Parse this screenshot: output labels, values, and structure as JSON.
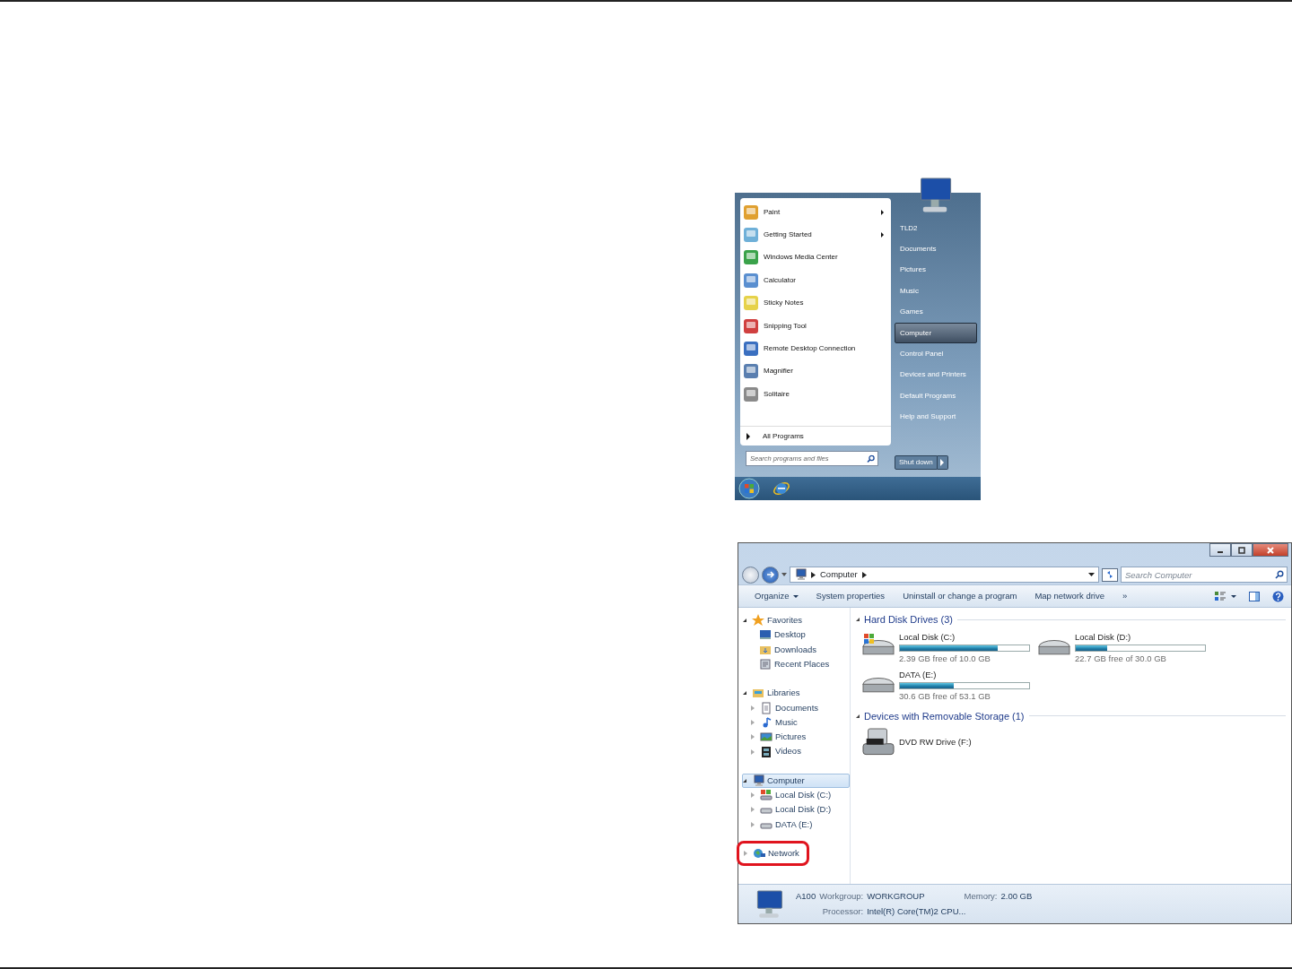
{
  "start_menu": {
    "programs": [
      {
        "label": "Paint",
        "has_submenu": true
      },
      {
        "label": "Getting Started",
        "has_submenu": true
      },
      {
        "label": "Windows Media Center",
        "has_submenu": false
      },
      {
        "label": "Calculator",
        "has_submenu": false
      },
      {
        "label": "Sticky Notes",
        "has_submenu": false
      },
      {
        "label": "Snipping Tool",
        "has_submenu": false
      },
      {
        "label": "Remote Desktop Connection",
        "has_submenu": false
      },
      {
        "label": "Magnifier",
        "has_submenu": false
      },
      {
        "label": "Solitaire",
        "has_submenu": false
      }
    ],
    "all_programs": "All Programs",
    "search": {
      "placeholder": "Search programs and files"
    },
    "places": [
      {
        "label": "TLD2",
        "selected": false
      },
      {
        "label": "Documents",
        "selected": false
      },
      {
        "label": "Pictures",
        "selected": false
      },
      {
        "label": "Music",
        "selected": false
      },
      {
        "label": "Games",
        "selected": false
      },
      {
        "label": "Computer",
        "selected": true
      },
      {
        "label": "Control Panel",
        "selected": false
      },
      {
        "label": "Devices and Printers",
        "selected": false
      },
      {
        "label": "Default Programs",
        "selected": false
      },
      {
        "label": "Help and Support",
        "selected": false
      }
    ],
    "shutdown": "Shut down"
  },
  "explorer": {
    "address": [
      "Computer"
    ],
    "search": {
      "placeholder": "Search Computer"
    },
    "toolbar": [
      {
        "label": "Organize",
        "dropdown": true
      },
      {
        "label": "System properties",
        "dropdown": false
      },
      {
        "label": "Uninstall or change a program",
        "dropdown": false
      },
      {
        "label": "Map network drive",
        "dropdown": false
      },
      {
        "label": "»",
        "dropdown": false
      }
    ],
    "navigation": [
      {
        "label": "Favorites",
        "kind": "favorites",
        "expanded": true,
        "selected": false,
        "highlighted": false,
        "children": [
          {
            "label": "Desktop",
            "kind": "desktop",
            "selected": false
          },
          {
            "label": "Downloads",
            "kind": "folder",
            "selected": false
          },
          {
            "label": "Recent Places",
            "kind": "recent",
            "selected": false
          }
        ]
      },
      {
        "label": "Libraries",
        "kind": "library",
        "expanded": true,
        "selected": false,
        "highlighted": false,
        "children": [
          {
            "label": "Documents",
            "kind": "document",
            "expanded": false,
            "selected": false
          },
          {
            "label": "Music",
            "kind": "music",
            "expanded": false,
            "selected": false
          },
          {
            "label": "Pictures",
            "kind": "picture",
            "expanded": false,
            "selected": false
          },
          {
            "label": "Videos",
            "kind": "video",
            "expanded": false,
            "selected": false
          }
        ]
      },
      {
        "label": "Computer",
        "kind": "computer",
        "expanded": true,
        "selected": true,
        "highlighted": false,
        "children": [
          {
            "label": "Local Disk (C:)",
            "kind": "system-disk",
            "expanded": false,
            "selected": false
          },
          {
            "label": "Local Disk (D:)",
            "kind": "disk",
            "expanded": false,
            "selected": false
          },
          {
            "label": "DATA (E:)",
            "kind": "disk",
            "expanded": false,
            "selected": false
          }
        ]
      },
      {
        "label": "Network",
        "kind": "network",
        "expanded": false,
        "selected": false,
        "highlighted": true
      }
    ],
    "groups": [
      {
        "title": "Hard Disk Drives (3)",
        "items": [
          {
            "name": "Local Disk (C:)",
            "kind": "system-disk",
            "level": 0.76,
            "detail": "2.39 GB free of 10.0 GB"
          },
          {
            "name": "Local Disk (D:)",
            "kind": "disk",
            "level": 0.24,
            "detail": "22.7 GB free of 30.0 GB"
          },
          {
            "name": "DATA (E:)",
            "kind": "disk",
            "level": 0.42,
            "detail": "30.6 GB free of 53.1 GB"
          }
        ]
      },
      {
        "title": "Devices with Removable Storage (1)",
        "items": [
          {
            "name": "DVD RW Drive (F:)",
            "kind": "dvd"
          }
        ]
      }
    ],
    "details": {
      "name": "A100",
      "fields": [
        {
          "label": "Workgroup:",
          "value": "WORKGROUP"
        },
        {
          "label": "Memory:",
          "value": "2.00 GB"
        },
        {
          "label": "Processor:",
          "value": "Intel(R) Core(TM)2 CPU..."
        }
      ]
    }
  }
}
